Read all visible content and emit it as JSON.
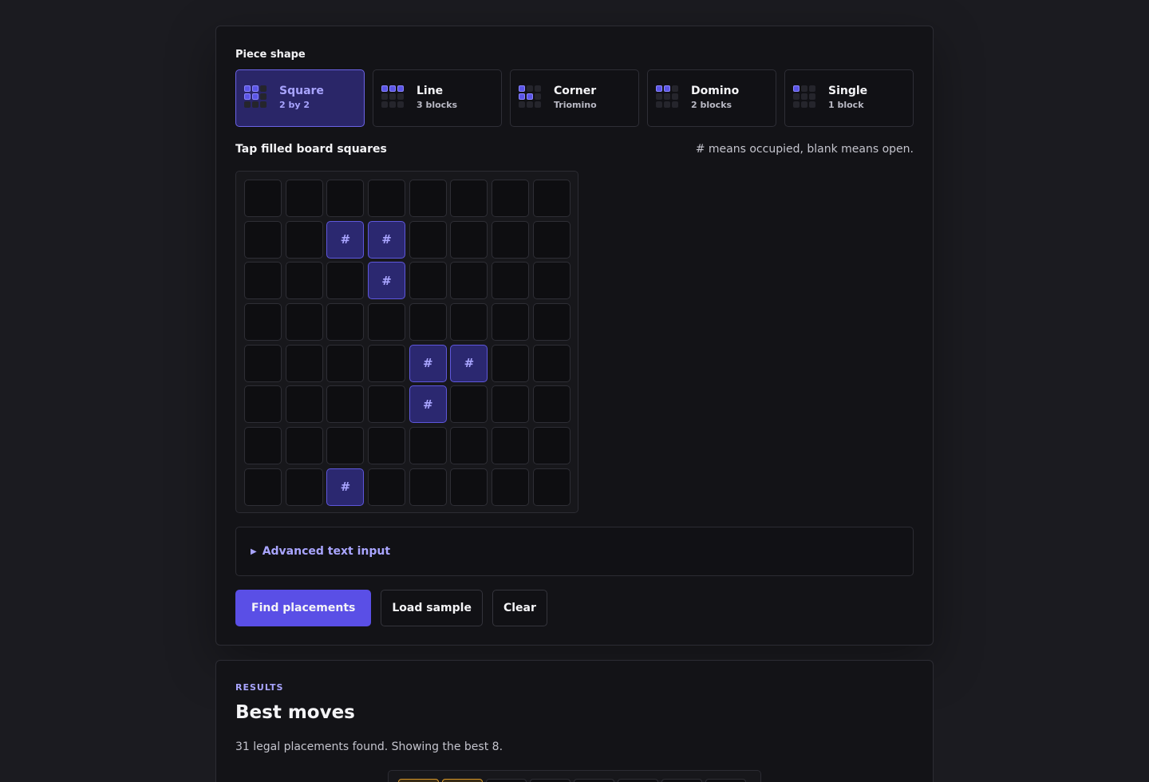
{
  "piece_shape": {
    "label": "Piece shape",
    "options": [
      {
        "name": "Square",
        "sub": "2 by 2",
        "selected": true,
        "pattern": [
          1,
          1,
          0,
          1,
          1,
          0,
          0,
          0,
          0
        ]
      },
      {
        "name": "Line",
        "sub": "3 blocks",
        "selected": false,
        "pattern": [
          1,
          1,
          1,
          0,
          0,
          0,
          0,
          0,
          0
        ]
      },
      {
        "name": "Corner",
        "sub": "Triomino",
        "selected": false,
        "pattern": [
          1,
          0,
          0,
          1,
          1,
          0,
          0,
          0,
          0
        ]
      },
      {
        "name": "Domino",
        "sub": "2 blocks",
        "selected": false,
        "pattern": [
          1,
          1,
          0,
          0,
          0,
          0,
          0,
          0,
          0
        ]
      },
      {
        "name": "Single",
        "sub": "1 block",
        "selected": false,
        "pattern": [
          1,
          0,
          0,
          0,
          0,
          0,
          0,
          0,
          0
        ]
      }
    ]
  },
  "board": {
    "label": "Tap filled board squares",
    "hint": "# means occupied, blank means open.",
    "filled_symbol": "#",
    "rows": [
      "........",
      "..##....",
      "...#....",
      "........",
      "....##..",
      "....#...",
      "........",
      "..#....."
    ]
  },
  "advanced": {
    "label": "Advanced text input",
    "icon": "triangle-right-icon"
  },
  "actions": {
    "find": "Find placements",
    "load": "Load sample",
    "clear": "Clear"
  },
  "results": {
    "kicker": "RESULTS",
    "title": "Best moves",
    "summary": "31 legal placements found. Showing the best 8.",
    "preview_highlight": [
      1,
      1,
      0,
      0,
      0,
      0,
      0,
      0
    ]
  },
  "colors": {
    "accent": "#5a4fe6",
    "accent_text": "#a9a5ff",
    "highlight": "#d99a2b",
    "background": "#1b1b20",
    "card": "#131317"
  }
}
